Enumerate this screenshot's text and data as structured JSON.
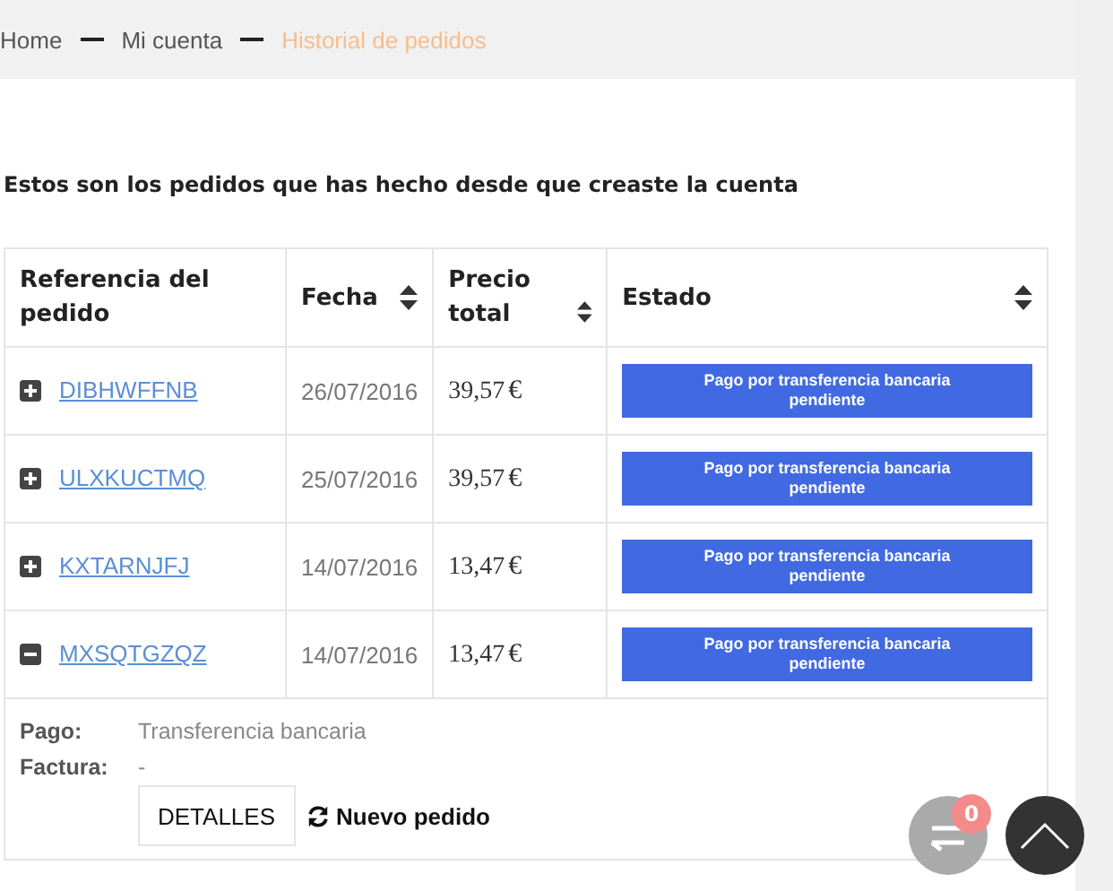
{
  "breadcrumb": [
    {
      "label": "Home",
      "current": false
    },
    {
      "label": "Mi cuenta",
      "current": false
    },
    {
      "label": "Historial de pedidos",
      "current": true
    }
  ],
  "heading": "Estos son los pedidos que has hecho desde que creaste la cuenta",
  "table": {
    "columns": [
      {
        "label": "Referencia del pedido",
        "sortable": false
      },
      {
        "label": "Fecha",
        "sortable": true
      },
      {
        "label": "Precio total",
        "sortable": true
      },
      {
        "label": "Estado",
        "sortable": true
      }
    ],
    "rows": [
      {
        "reference": "DIBHWFFNB",
        "date": "26/07/2016",
        "price": "39,57",
        "currency": "€",
        "status": "Pago por transferencia bancaria pendiente",
        "expanded": false
      },
      {
        "reference": "ULXKUCTMQ",
        "date": "25/07/2016",
        "price": "39,57",
        "currency": "€",
        "status": "Pago por transferencia bancaria pendiente",
        "expanded": false
      },
      {
        "reference": "KXTARNJFJ",
        "date": "14/07/2016",
        "price": "13,47",
        "currency": "€",
        "status": "Pago por transferencia bancaria pendiente",
        "expanded": false
      },
      {
        "reference": "MXSQTGZQZ",
        "date": "14/07/2016",
        "price": "13,47",
        "currency": "€",
        "status": "Pago por transferencia bancaria pendiente",
        "expanded": true
      }
    ]
  },
  "details": {
    "fields": [
      {
        "label": "Pago:",
        "value": "Transferencia bancaria"
      },
      {
        "label": "Factura:",
        "value": "-"
      }
    ],
    "details_button": "DETALLES",
    "reorder_link": "Nuevo pedido"
  },
  "compare_badge": "0"
}
